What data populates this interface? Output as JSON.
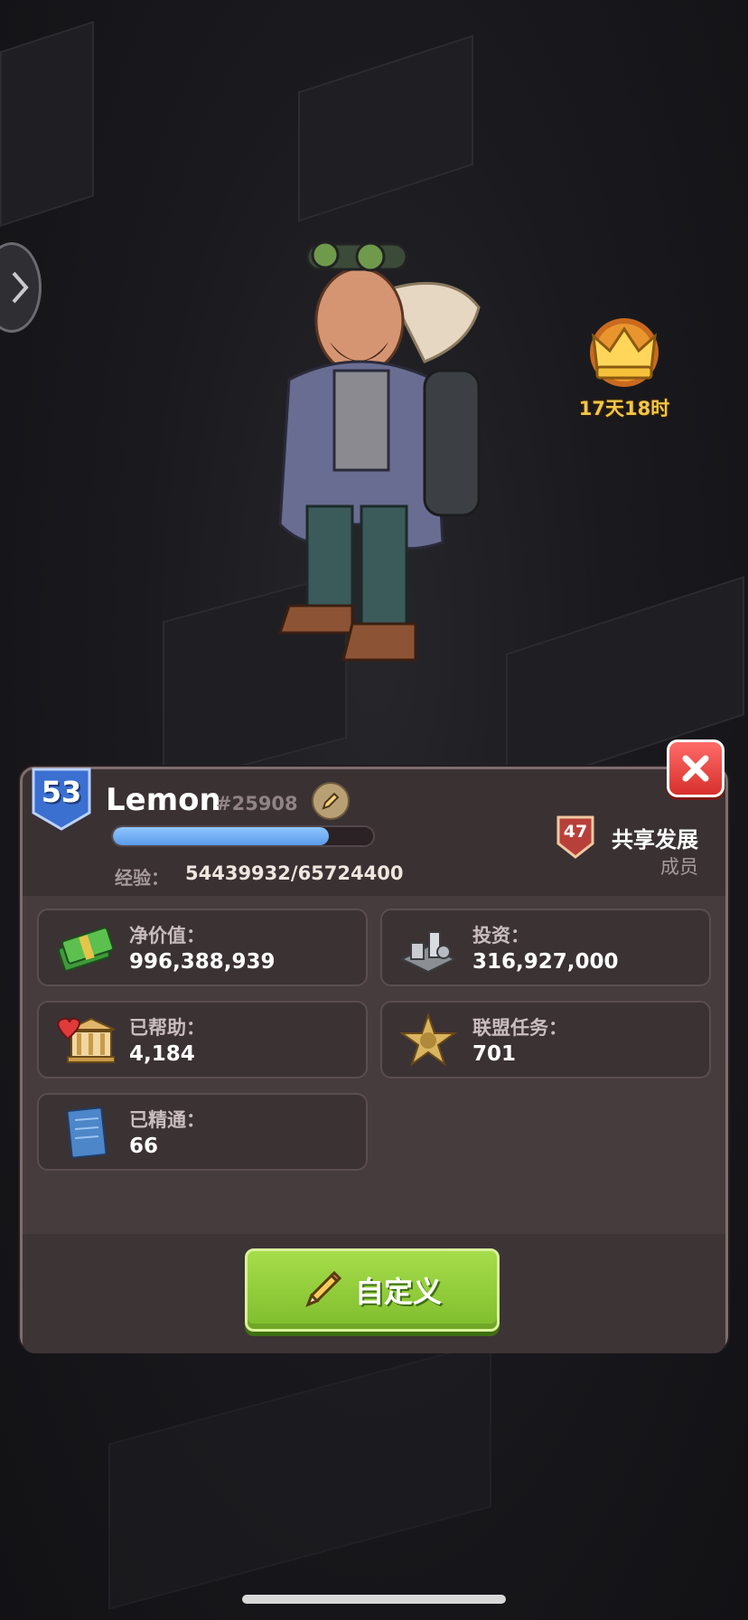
{
  "crown": {
    "icon": "crown-icon",
    "timer": "17天18时"
  },
  "profile": {
    "level": "53",
    "name": "Lemon",
    "id": "#25908",
    "xp_label": "经验：",
    "xp_value": "54439932/65724400",
    "xp_progress": 0.83
  },
  "alliance": {
    "level": "47",
    "name": "共享发展",
    "role": "成员"
  },
  "stats": {
    "net_worth": {
      "label": "净价值：",
      "value": "996,388,939",
      "icon": "cash-stack-icon"
    },
    "investment": {
      "label": "投资：",
      "value": "316,927,000",
      "icon": "factory-icon"
    },
    "helped": {
      "label": "已帮助：",
      "value": "4,184",
      "icon": "bank-heart-icon"
    },
    "alliance_tasks": {
      "label": "联盟任务：",
      "value": "701",
      "icon": "sheriff-star-icon"
    },
    "mastered": {
      "label": "已精通：",
      "value": "66",
      "icon": "blueprint-icon"
    }
  },
  "buttons": {
    "customize": "自定义"
  },
  "colors": {
    "accent_green": "#8fcb3a",
    "close_red": "#e2403c",
    "xp_blue": "#6aa8f0",
    "level_blue": "#3b6fd0"
  }
}
